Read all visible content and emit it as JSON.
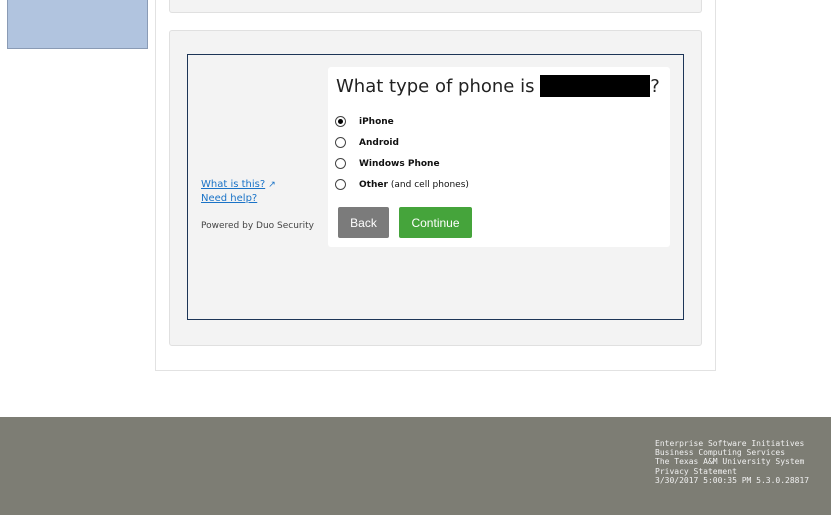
{
  "duo": {
    "question_prefix": "What type of phone is",
    "question_suffix": "?",
    "options": [
      {
        "label": "iPhone",
        "extra": "",
        "selected": true
      },
      {
        "label": "Android",
        "extra": "",
        "selected": false
      },
      {
        "label": "Windows Phone",
        "extra": "",
        "selected": false
      },
      {
        "label": "Other",
        "extra": "(and cell phones)",
        "selected": false
      }
    ],
    "back_label": "Back",
    "continue_label": "Continue",
    "what_is_this": "What is this?",
    "need_help": "Need help?",
    "powered_by": "Powered by Duo Security"
  },
  "footer": {
    "line1": "Enterprise Software Initiatives",
    "line2": "Business Computing Services",
    "line3": "The Texas A&M University System",
    "privacy": "Privacy Statement",
    "timestamp_version": "3/30/2017 5:00:35 PM  5.3.0.28817"
  },
  "colors": {
    "continue": "#45a43b",
    "back": "#7b7b7b",
    "link": "#1a73c7",
    "footer_bg": "#7d7d74"
  }
}
